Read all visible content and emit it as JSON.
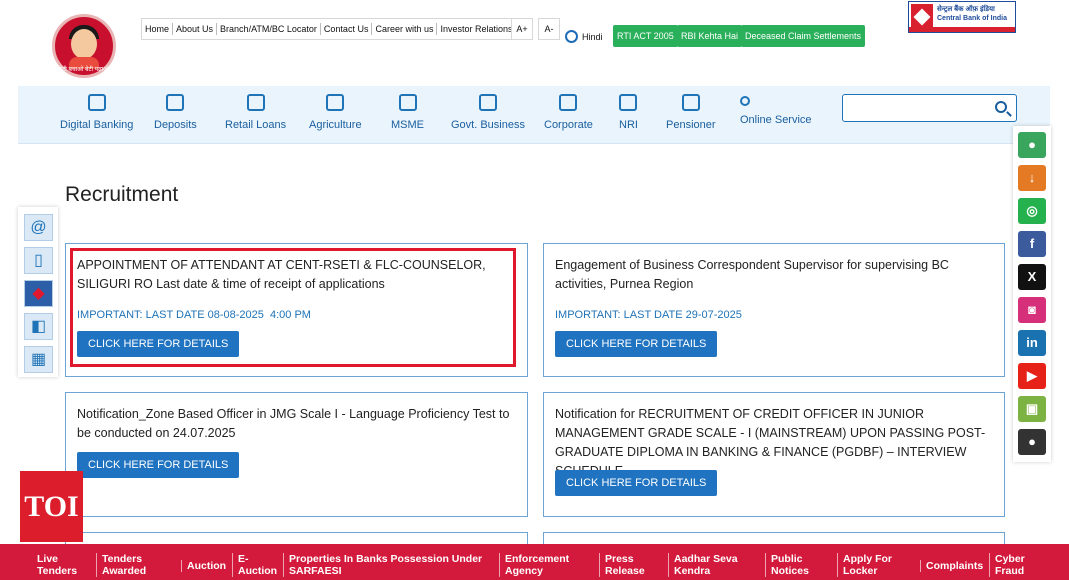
{
  "header": {
    "logo_text": "बेटी बचाओ बेटी पढ़ाओ",
    "top_links": [
      "Home",
      "About Us",
      "Branch/ATM/BC Locator",
      "Contact Us",
      "Career with us",
      "Investor Relations"
    ],
    "font_increase": "A+",
    "font_decrease": "A-",
    "language": "Hindi",
    "green_buttons": [
      "RTI ACT 2005",
      "RBI Kehta Hai",
      "Deceased Claim Settlements"
    ],
    "bank_name_hindi": "सेन्ट्रल बैंक ऑफ़ इंडिया",
    "bank_name": "Central Bank of India"
  },
  "nav": {
    "items": [
      "Digital Banking",
      "Deposits",
      "Retail Loans",
      "Agriculture",
      "MSME",
      "Govt. Business",
      "Corporate",
      "NRI",
      "Pensioner",
      "Online Service"
    ],
    "search_placeholder": ""
  },
  "page": {
    "title": "Recruitment"
  },
  "cards": [
    {
      "title": "APPOINTMENT OF ATTENDANT AT CENT-RSETI & FLC-COUNSELOR, SILIGURI RO Last date & time of receipt of applications",
      "important": "IMPORTANT: LAST DATE 08-08-2025  4:00 PM",
      "button": "CLICK HERE FOR DETAILS"
    },
    {
      "title": "Engagement of Business Correspondent Supervisor for supervising BC activities, Purnea Region",
      "important": "IMPORTANT: LAST DATE 29-07-2025",
      "button": "CLICK HERE FOR DETAILS"
    },
    {
      "title": "Notification_Zone Based Officer in JMG Scale I - Language Proficiency Test to be conducted on 24.07.2025",
      "important": "",
      "button": "CLICK HERE FOR DETAILS"
    },
    {
      "title": "Notification for RECRUITMENT OF CREDIT OFFICER IN JUNIOR MANAGEMENT GRADE SCALE - I (MAINSTREAM) UPON PASSING POST-GRADUATE DIPLOMA IN BANKING & FINANCE (PGDBF) – INTERVIEW SCHEDULE",
      "important": "",
      "button": "CLICK HERE FOR DETAILS"
    }
  ],
  "left_quick_icons": [
    "email-icon",
    "mobile-icon",
    "bank-logo-icon",
    "payment-icon",
    "calculator-icon"
  ],
  "social_icons": [
    "contact-icon",
    "download-icon",
    "whatsapp-icon",
    "facebook-icon",
    "x-icon",
    "instagram-icon",
    "linkedin-icon",
    "youtube-icon",
    "android-icon",
    "apple-icon"
  ],
  "social_glyphs": {
    "linkedin": "in",
    "facebook": "f",
    "x": "X"
  },
  "badge": "TOI",
  "footer": {
    "links": [
      [
        "Live",
        "Tenders"
      ],
      [
        "Tenders",
        "Awarded"
      ],
      [
        "Auction",
        ""
      ],
      [
        "E-",
        "Auction"
      ],
      [
        "Properties In Banks Possession Under",
        "SARFAESI"
      ],
      [
        "Enforcement",
        "Agency"
      ],
      [
        "Press",
        "Release"
      ],
      [
        "Aadhar Seva",
        "Kendra"
      ],
      [
        "Public",
        "Notices"
      ],
      [
        "Apply For",
        "Locker"
      ],
      [
        "Complaints",
        ""
      ],
      [
        "Cyber",
        "Fraud"
      ]
    ]
  },
  "colors": {
    "accent": "#1f73c0",
    "brand_red": "#d41a3c",
    "green": "#2ab05a",
    "highlight": "#e0182d"
  }
}
